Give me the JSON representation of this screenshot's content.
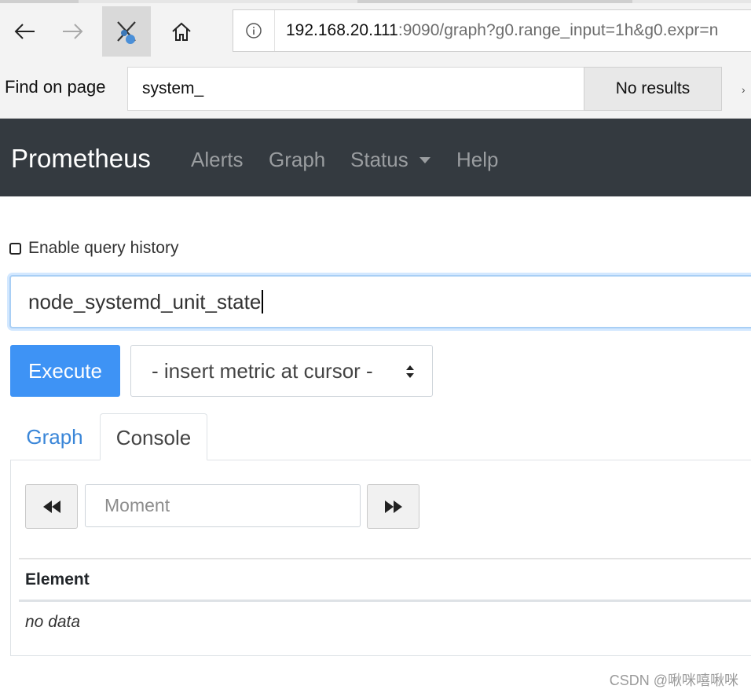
{
  "browser": {
    "url_host": "192.168.20.111",
    "url_rest": ":9090/graph?g0.range_input=1h&g0.expr=n",
    "find_label": "Find on page",
    "find_query": "system_",
    "find_results": "No results"
  },
  "navbar": {
    "brand": "Prometheus",
    "links": [
      "Alerts",
      "Graph",
      "Status",
      "Help"
    ],
    "background": "#343a40"
  },
  "query": {
    "history_label": "Enable query history",
    "history_checked": false,
    "expression": "node_systemd_unit_state",
    "execute_label": "Execute",
    "metric_select_placeholder": "- insert metric at cursor -",
    "accent": "#3e93f5"
  },
  "tabs": [
    {
      "label": "Graph",
      "active": false
    },
    {
      "label": "Console",
      "active": true
    }
  ],
  "console": {
    "moment_placeholder": "Moment",
    "column_header": "Element",
    "empty_text": "no data"
  },
  "watermark": "CSDN @啾咪嘻啾咪"
}
